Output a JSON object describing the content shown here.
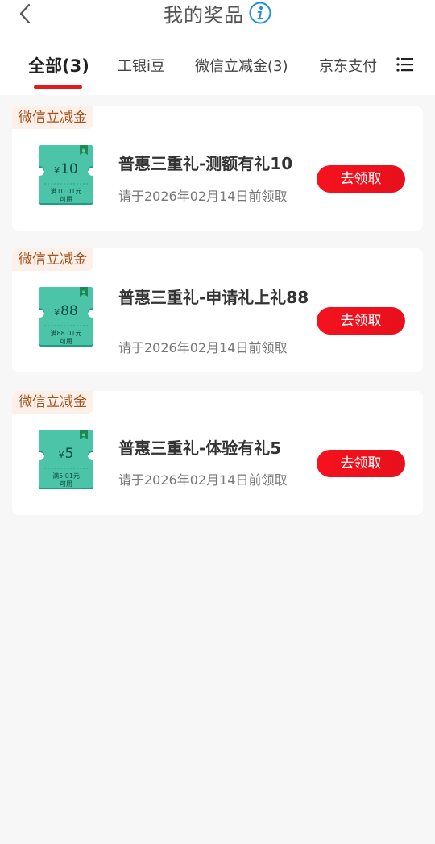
{
  "header": {
    "title": "我的奖品",
    "back_icon": "chevron-left-icon",
    "info_icon": "info-icon"
  },
  "tabs": [
    {
      "label": "全部(3)",
      "active": true
    },
    {
      "label": "工银i豆",
      "active": false
    },
    {
      "label": "微信立减金(3)",
      "active": false
    },
    {
      "label": "京东支付",
      "active": false
    }
  ],
  "colors": {
    "accent": "#e5181a",
    "button": "#f5121e",
    "tag_bg": "#fdf0e8",
    "tag_text": "#a4531e",
    "coupon_green": "#3cb89b"
  },
  "prizes": [
    {
      "tag": "微信立减金",
      "currency": "¥",
      "amount": "10",
      "cond_line1": "满10.01元",
      "cond_line2": "可用",
      "name": "普惠三重礼-测额有礼10",
      "deadline": "请于2026年02月14日前领取",
      "button": "去领取"
    },
    {
      "tag": "微信立减金",
      "currency": "¥",
      "amount": "88",
      "cond_line1": "满88.01元",
      "cond_line2": "可用",
      "name": "普惠三重礼-申请礼上礼88",
      "deadline": "请于2026年02月14日前领取",
      "button": "去领取"
    },
    {
      "tag": "微信立减金",
      "currency": "¥",
      "amount": "5",
      "cond_line1": "满5.01元",
      "cond_line2": "可用",
      "name": "普惠三重礼-体验有礼5",
      "deadline": "请于2026年02月14日前领取",
      "button": "去领取"
    }
  ]
}
